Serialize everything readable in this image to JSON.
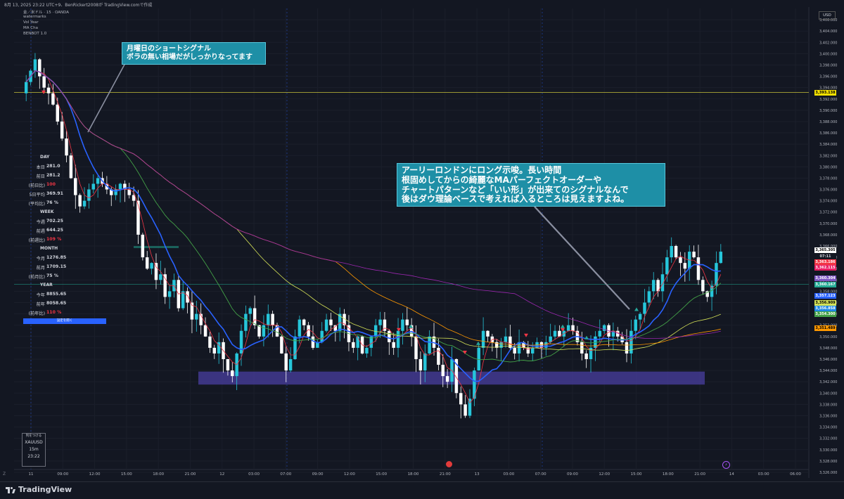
{
  "header": {
    "title": "8月 13, 2025 23:22 UTC+9、BenRickert2008が TradingView.comで作成"
  },
  "legend": [
    "金／米ドル · 15 · OANDA",
    "watermarks",
    "Vol Year",
    "MA Cha",
    "BENBOT 1.0"
  ],
  "currency": "USD",
  "stats": {
    "day_header": "DAY",
    "day": [
      {
        "label": "本日",
        "value": "281.0"
      },
      {
        "label": "前日",
        "value": "281.2"
      },
      {
        "label": "(前日比)",
        "value": "100",
        "red": true
      },
      {
        "label": "5日平均",
        "value": "369.91"
      },
      {
        "label": "(平均比)",
        "value": "76 %"
      }
    ],
    "week_header": "WEEK",
    "week": [
      {
        "label": "今週",
        "value": "702.25"
      },
      {
        "label": "前週",
        "value": "644.25"
      },
      {
        "label": "(前週比)",
        "value": "109 %",
        "red": true
      }
    ],
    "month_header": "MONTH",
    "month": [
      {
        "label": "今月",
        "value": "1276.85"
      },
      {
        "label": "前月",
        "value": "1709.15"
      },
      {
        "label": "(前月比)",
        "value": "75 %"
      }
    ],
    "year_header": "YEAR",
    "year": [
      {
        "label": "今年",
        "value": "8855.65"
      },
      {
        "label": "前年",
        "value": "8058.65"
      },
      {
        "label": "(前年比)",
        "value": "110 %",
        "red": true
      }
    ],
    "button_label": "設定を開く"
  },
  "callouts": {
    "first": [
      "月曜日のショートシグナル",
      "ボラの無い相場だがしっかりなってます"
    ],
    "second": [
      "アーリーロンドンにロング示唆。長い時間",
      "根固めしてからの綺麗なMAパーフェクトオーダーや",
      "チャートパターンなど「いい形」が出来てのシグナルなんで",
      "後はダウ理論ベースで考えれば入るところは見えますよね。"
    ]
  },
  "symbol_box": {
    "line1": "列をつける",
    "symbol": "XAUUSD",
    "interval": "15m",
    "time": "23:22"
  },
  "price_tags": [
    {
      "label": "3,393.138",
      "price": 3393.138,
      "bg": "#f5e000",
      "fg": "#000"
    },
    {
      "label": "3,365.305",
      "price": 3365.305,
      "bg": "#ffffff",
      "fg": "#000"
    },
    {
      "label": "07:11",
      "price": 3364.2,
      "bg": "#131722",
      "fg": "#d1d4dc"
    },
    {
      "label": "3,363.186",
      "price": 3363.186,
      "bg": "#f23645",
      "fg": "#fff"
    },
    {
      "label": "3,362.115",
      "price": 3362.115,
      "bg": "#e91e63",
      "fg": "#fff"
    },
    {
      "label": "3,360.304",
      "price": 3360.304,
      "bg": "#7e57c2",
      "fg": "#fff"
    },
    {
      "label": "3,360.167",
      "price": 3359.2,
      "bg": "#22ab94",
      "fg": "#fff"
    },
    {
      "label": "3,357.123",
      "price": 3357.123,
      "bg": "#2962ff",
      "fg": "#fff"
    },
    {
      "label": "3,356.909",
      "price": 3356.0,
      "bg": "#d4e157",
      "fg": "#000"
    },
    {
      "label": "3,356.858",
      "price": 3355.0,
      "bg": "#1e88e5",
      "fg": "#fff"
    },
    {
      "label": "3,354.300",
      "price": 3354.0,
      "bg": "#43a047",
      "fg": "#fff"
    },
    {
      "label": "3,351.489",
      "price": 3351.489,
      "bg": "#ff9800",
      "fg": "#000"
    }
  ],
  "chart_data": {
    "type": "candlestick",
    "title": "金／米ドル · 15 · OANDA",
    "y_ticks": [
      3326,
      3328,
      3330,
      3332,
      3334,
      3336,
      3338,
      3340,
      3342,
      3344,
      3346,
      3348,
      3350,
      3352,
      3354,
      3356,
      3358,
      3360,
      3362,
      3364,
      3366,
      3368,
      3370,
      3372,
      3374,
      3376,
      3378,
      3380,
      3382,
      3384,
      3386,
      3388,
      3390,
      3392,
      3394,
      3396,
      3398,
      3400,
      3402,
      3404,
      3406
    ],
    "x_ticks": [
      "11",
      "09:00",
      "12:00",
      "15:00",
      "18:00",
      "21:00",
      "12",
      "03:00",
      "07:00",
      "09:00",
      "12:00",
      "15:00",
      "18:00",
      "21:00",
      "13",
      "03:00",
      "07:00",
      "09:00",
      "12:00",
      "15:00",
      "18:00",
      "21:00",
      "14",
      "03:00",
      "06:00"
    ],
    "ylim": [
      3325,
      3408
    ],
    "horizontal_lines": [
      3393.138,
      3359.2
    ],
    "purple_zone": [
      3341.5,
      3343.8
    ],
    "candles_close": [
      3395,
      3397,
      3399,
      3396,
      3394,
      3393,
      3391,
      3388,
      3385,
      3382,
      3378,
      3375,
      3373,
      3374,
      3376,
      3377,
      3378,
      3377,
      3376,
      3375,
      3376,
      3377,
      3376,
      3375,
      3374,
      3368,
      3364,
      3362,
      3363,
      3360,
      3361,
      3357,
      3358,
      3360,
      3355,
      3358,
      3356,
      3353,
      3354,
      3352,
      3350,
      3348,
      3347,
      3349,
      3346,
      3344,
      3343,
      3347,
      3351,
      3354,
      3355,
      3352,
      3350,
      3352,
      3354,
      3352,
      3350,
      3347,
      3344,
      3346,
      3350,
      3353,
      3352,
      3350,
      3348,
      3349,
      3351,
      3353,
      3352,
      3351,
      3354,
      3352,
      3349,
      3348,
      3350,
      3347,
      3348,
      3350,
      3352,
      3353,
      3351,
      3349,
      3348,
      3351,
      3353,
      3352,
      3350,
      3346,
      3344,
      3347,
      3350,
      3348,
      3345,
      3343,
      3342,
      3346,
      3340,
      3338,
      3336,
      3339,
      3344,
      3348,
      3351,
      3350,
      3349,
      3348,
      3349,
      3350,
      3348,
      3347,
      3349,
      3348,
      3347,
      3348,
      3349,
      3348,
      3349,
      3350,
      3351,
      3350,
      3351,
      3352,
      3351,
      3349,
      3347,
      3346,
      3348,
      3350,
      3351,
      3352,
      3350,
      3351,
      3350,
      3349,
      3347,
      3351,
      3353,
      3354,
      3356,
      3358,
      3360,
      3358,
      3361,
      3364,
      3366,
      3364,
      3363,
      3362,
      3365,
      3364,
      3360,
      3358,
      3357,
      3359,
      3363,
      3365
    ]
  }
}
